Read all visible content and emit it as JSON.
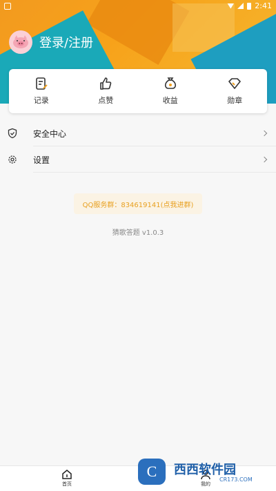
{
  "status": {
    "time": "2:41"
  },
  "profile": {
    "login_label": "登录/注册"
  },
  "shortcuts": [
    {
      "label": "记录",
      "icon": "record-icon"
    },
    {
      "label": "点赞",
      "icon": "thumbs-up-icon"
    },
    {
      "label": "收益",
      "icon": "money-bag-icon"
    },
    {
      "label": "勋章",
      "icon": "diamond-icon"
    }
  ],
  "menu": [
    {
      "label": "安全中心",
      "icon": "shield-icon"
    },
    {
      "label": "设置",
      "icon": "gear-icon"
    }
  ],
  "qq_group": "QQ服务群：834619141(点我进群)",
  "version": "猜歌答题 v1.0.3",
  "tabs": [
    {
      "label": "首页",
      "icon": "home-icon"
    },
    {
      "label": "我的",
      "icon": "user-icon"
    }
  ],
  "watermark": {
    "badge": "C",
    "text": "西西软件园",
    "url": "CR173.COM"
  },
  "colors": {
    "accent": "#f5a21c",
    "teal": "#1aa9b8",
    "qq_text": "#e8a020"
  }
}
